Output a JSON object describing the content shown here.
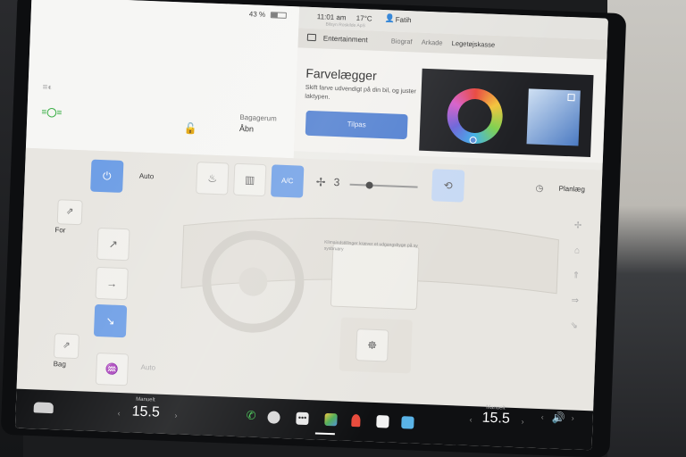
{
  "status": {
    "battery_label": "43 %",
    "battery_level": 0.43
  },
  "car_panel": {
    "trunk_label": "Bagagerum",
    "trunk_action": "Åbn"
  },
  "top_bar": {
    "time": "11:01 am",
    "temperature": "17°C",
    "user": "Fatih",
    "map_text": "Bilsyn Roskilde ApS"
  },
  "entertainment": {
    "title": "Entertainment",
    "tabs": [
      {
        "label": "Biograf"
      },
      {
        "label": "Arkade"
      },
      {
        "label": "Legetøjskasse"
      }
    ],
    "app_title": "Farvelægger",
    "app_description": "Skift farve udvendigt på din bil, og juster laktypen.",
    "button_label": "Tilpas"
  },
  "climate": {
    "auto_label": "Auto",
    "ac_label": "A/C",
    "fan_speed": "3",
    "fan_level": 0.25,
    "schedule_label": "Planlæg",
    "front_label": "For",
    "rear_label": "Bag",
    "seat_auto_label": "Auto",
    "dash_note": "Klimaindstillinger kræver et udgangsbyge på sy sysbruary"
  },
  "dock": {
    "driver": {
      "mode": "Manuelt",
      "temperature": "15.5"
    },
    "passenger": {
      "mode": "Manuelt",
      "temperature": "15.5"
    }
  },
  "icons": {
    "lights": "headlights-icon",
    "green_lights": "parking-lights-icon",
    "lock": "unlock-icon",
    "entertainment": "entertainment-icon",
    "power": "power-icon",
    "fan": "fan-icon",
    "recirc": "recirculation-icon",
    "phone": "phone-icon",
    "volume": "volume-icon"
  },
  "colors": {
    "accent_blue": "#6f9fe6",
    "button_blue": "#4f7ed0",
    "dock_bg": "#0f1012"
  }
}
